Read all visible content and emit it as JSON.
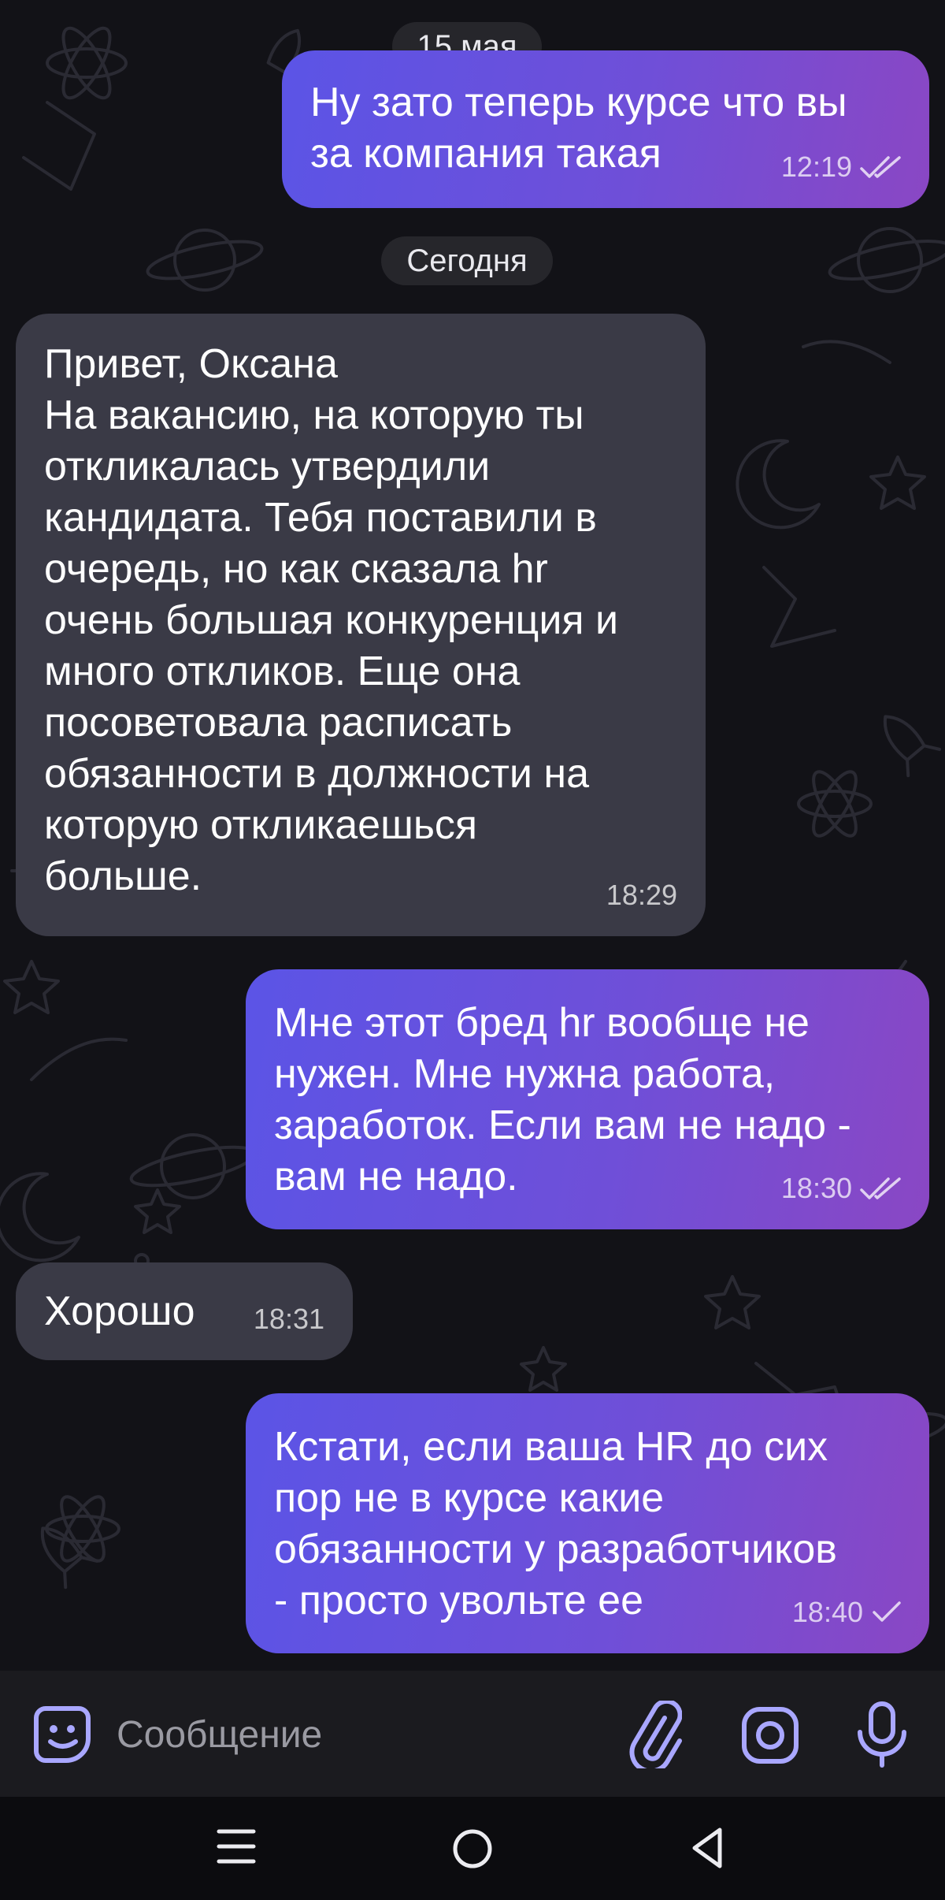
{
  "chat": {
    "date_separators": [
      "15 мая",
      "Сегодня"
    ],
    "messages": [
      {
        "direction": "out",
        "text": "Ну зато теперь курсе что вы\nза компания такая",
        "time": "12:19",
        "status": "read"
      },
      {
        "direction": "in",
        "text": "Привет, Оксана\nНа вакансию, на которую ты\nоткликалась утвердили\nкандидата. Тебя поставили в\nочередь, но как сказала hr\nочень большая конкуренция и\nмного откликов. Еще она\nпосоветовала расписать\nобязанности в должности на\nкоторую откликаешься\nбольше.",
        "time": "18:29"
      },
      {
        "direction": "out",
        "text": "Мне этот бред hr вообще не\nнужен. Мне нужна работа,\nзаработок. Если вам не надо -\nвам не надо.",
        "time": "18:30",
        "status": "read"
      },
      {
        "direction": "in",
        "text": "Хорошо",
        "time": "18:31"
      },
      {
        "direction": "out",
        "text": "Кстати, если ваша HR до сих\nпор не в курсе какие\nобязанности у разработчиков\n- просто увольте ее",
        "time": "18:40",
        "status": "sent"
      }
    ]
  },
  "composer": {
    "placeholder": "Сообщение",
    "icons": [
      "sticker-icon",
      "paperclip-icon",
      "camera-icon",
      "microphone-icon"
    ]
  },
  "navbar": {
    "icons": [
      "menu-icon",
      "home-icon",
      "back-icon"
    ]
  },
  "colors": {
    "background": "#121217",
    "incoming_bubble": "#3a3a46",
    "outgoing_gradient_start": "#5b54e6",
    "outgoing_gradient_end": "#8a47c4",
    "accent": "#7d6bff"
  }
}
